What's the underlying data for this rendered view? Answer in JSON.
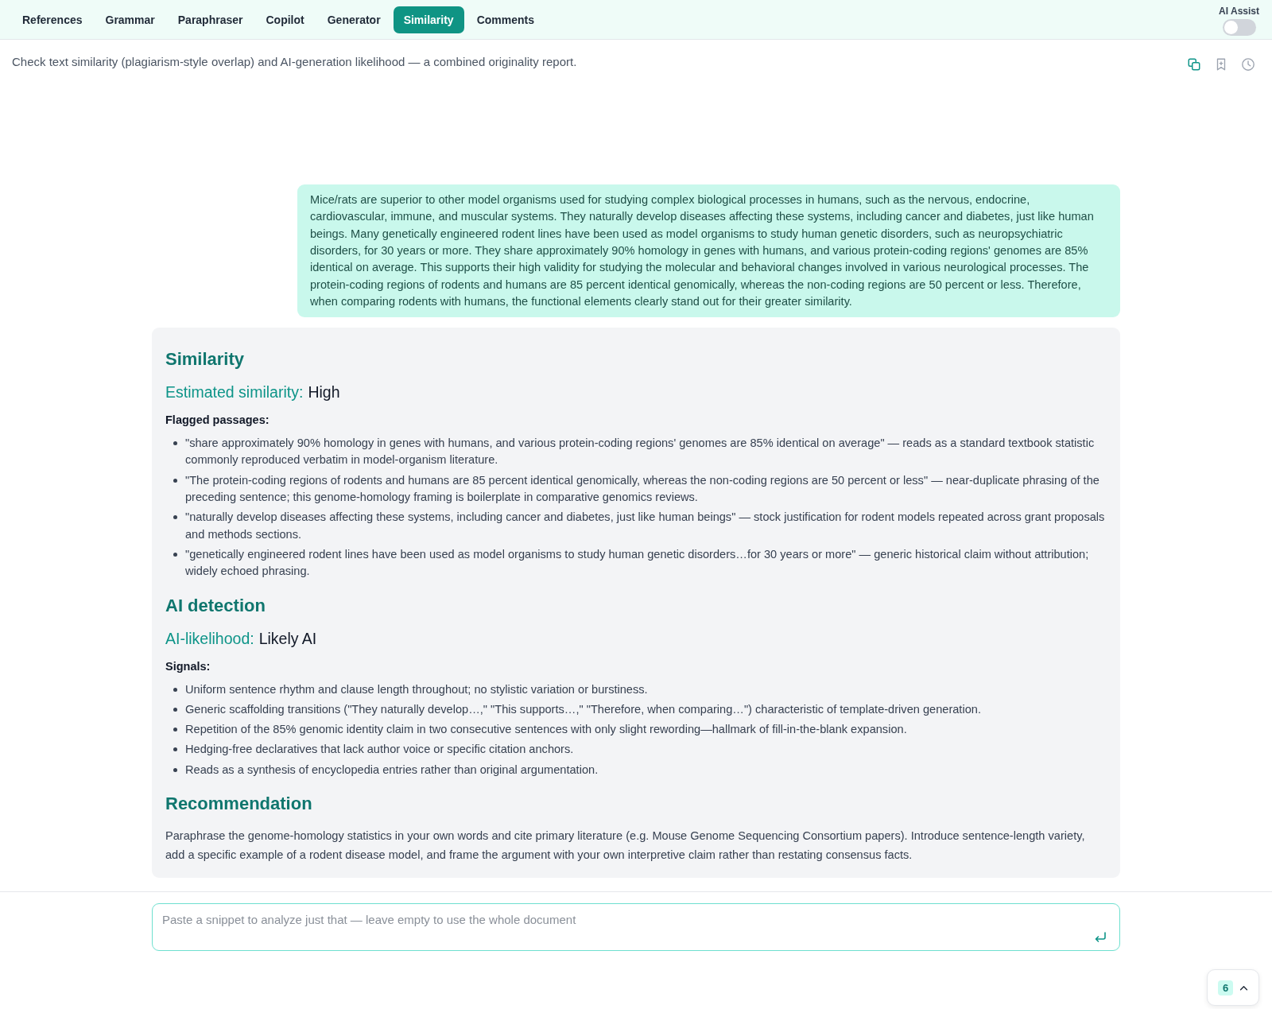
{
  "tabs": [
    {
      "label": "References",
      "selected": false
    },
    {
      "label": "Grammar",
      "selected": false
    },
    {
      "label": "Paraphraser",
      "selected": false
    },
    {
      "label": "Copilot",
      "selected": false
    },
    {
      "label": "Generator",
      "selected": false
    },
    {
      "label": "Similarity",
      "selected": true
    },
    {
      "label": "Comments",
      "selected": false
    }
  ],
  "ai_assist": {
    "label": "AI Assist",
    "on": false
  },
  "description": "Check text similarity (plagiarism-style overlap) and AI-generation likelihood — a combined originality report.",
  "user_message": "Mice/rats are superior to other model organisms used for studying complex biological processes in humans, such as the nervous, endocrine, cardiovascular, immune, and muscular systems. They naturally develop diseases affecting these systems, including cancer and diabetes, just like human beings. Many genetically engineered rodent lines have been used as model organisms to study human genetic disorders, such as neuropsychiatric disorders, for 30 years or more. They share approximately 90% homology in genes with humans, and various protein-coding regions' genomes are 85% identical on average. This supports their high validity for studying the molecular and behavioral changes involved in various neurological processes. The protein-coding regions of rodents and humans are 85 percent identical genomically, whereas the non-coding regions are 50 percent or less. Therefore, when comparing rodents with humans, the functional elements clearly stand out for their greater similarity.",
  "report": {
    "sections": [
      {
        "kind": "assessment",
        "heading": "Similarity",
        "metric_label": "Estimated similarity:",
        "metric_value": "High",
        "list_title": "Flagged passages:",
        "items": [
          "\"share approximately 90% homology in genes with humans, and various protein-coding regions' genomes are 85% identical on average\" — reads as a standard textbook statistic commonly reproduced verbatim in model-organism literature.",
          "\"The protein-coding regions of rodents and humans are 85 percent identical genomically, whereas the non-coding regions are 50 percent or less\" — near-duplicate phrasing of the preceding sentence; this genome-homology framing is boilerplate in comparative genomics reviews.",
          "\"naturally develop diseases affecting these systems, including cancer and diabetes, just like human beings\" — stock justification for rodent models repeated across grant proposals and methods sections.",
          "\"genetically engineered rodent lines have been used as model organisms to study human genetic disorders…for 30 years or more\" — generic historical claim without attribution; widely echoed phrasing."
        ]
      },
      {
        "kind": "assessment",
        "heading": "AI detection",
        "metric_label": "AI-likelihood:",
        "metric_value": "Likely AI",
        "list_title": "Signals:",
        "items": [
          "Uniform sentence rhythm and clause length throughout; no stylistic variation or burstiness.",
          "Generic scaffolding transitions (\"They naturally develop…,\" \"This supports…,\" \"Therefore, when comparing…\") characteristic of template-driven generation.",
          "Repetition of the 85% genomic identity claim in two consecutive sentences with only slight rewording—hallmark of fill-in-the-blank expansion.",
          "Hedging-free declaratives that lack author voice or specific citation anchors.",
          "Reads as a synthesis of encyclopedia entries rather than original argumentation."
        ]
      },
      {
        "kind": "paragraph",
        "heading": "Recommendation",
        "text": "Paraphrase the genome-homology statistics in your own words and cite primary literature (e.g. Mouse Genome Sequencing Consortium papers). Introduce sentence-length variety, add a specific example of a rodent disease model, and frame the argument with your own interpretive claim rather than restating consensus facts."
      }
    ]
  },
  "input": {
    "placeholder": "Paste a snippet to analyze just that — leave empty to use the whole document"
  },
  "counter": {
    "count": "6"
  }
}
